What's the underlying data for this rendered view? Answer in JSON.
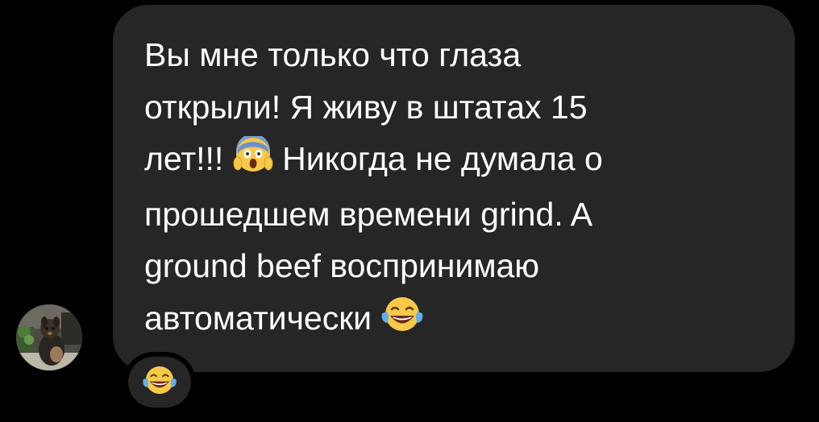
{
  "conversation": {
    "message": {
      "lines": [
        "Вы мне только что глаза",
        "открыли! Я живу в штатах 15",
        "лет!!!",
        "Никогда не думала о",
        "прошедшем времени grind. A",
        "ground beef воспринимаю",
        "автоматически"
      ],
      "bubble_color": "#262626",
      "text_color": "#ffffff"
    },
    "inline_emojis": [
      "face-screaming-in-fear-icon",
      "face-with-tears-of-joy-icon"
    ],
    "reaction": {
      "emoji": "face-with-tears-of-joy-icon"
    },
    "sender": {
      "avatar": "dog-photo-avatar"
    }
  }
}
